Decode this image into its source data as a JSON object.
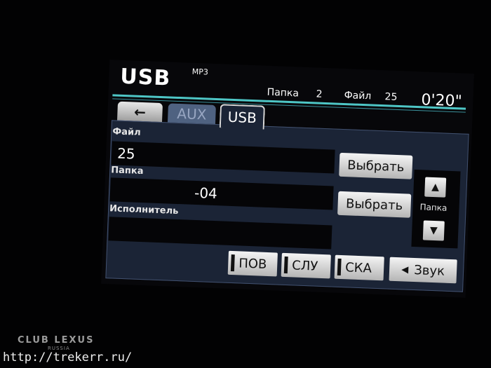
{
  "header": {
    "source": "USB",
    "format": "MP3",
    "folder_label": "Папка",
    "folder_num": "2",
    "file_label": "Файл",
    "file_num": "25",
    "time": "0'20\""
  },
  "tabs": {
    "back_glyph": "←",
    "aux": "AUX",
    "usb": "USB"
  },
  "fields": {
    "file_label": "Файл",
    "file_value": "25",
    "folder_label": "Папка",
    "folder_value": "-04",
    "artist_label": "Исполнитель",
    "artist_value": ""
  },
  "buttons": {
    "select_file": "Выбрать",
    "select_folder": "Выбрать",
    "folder_up": "▲",
    "folder_down": "▼",
    "folder_nav_label": "Папка",
    "repeat": "ПОВ",
    "random": "СЛУ",
    "scan": "СКА",
    "sound_icon": "◀",
    "sound": "Звук"
  },
  "footer": {
    "watermark": "CLUB LEXUS",
    "watermark_sub": "RUSSIA",
    "url": "http://trekerr.ru/"
  },
  "colors": {
    "accent": "#4ec6c6",
    "panel": "#1b2436"
  }
}
